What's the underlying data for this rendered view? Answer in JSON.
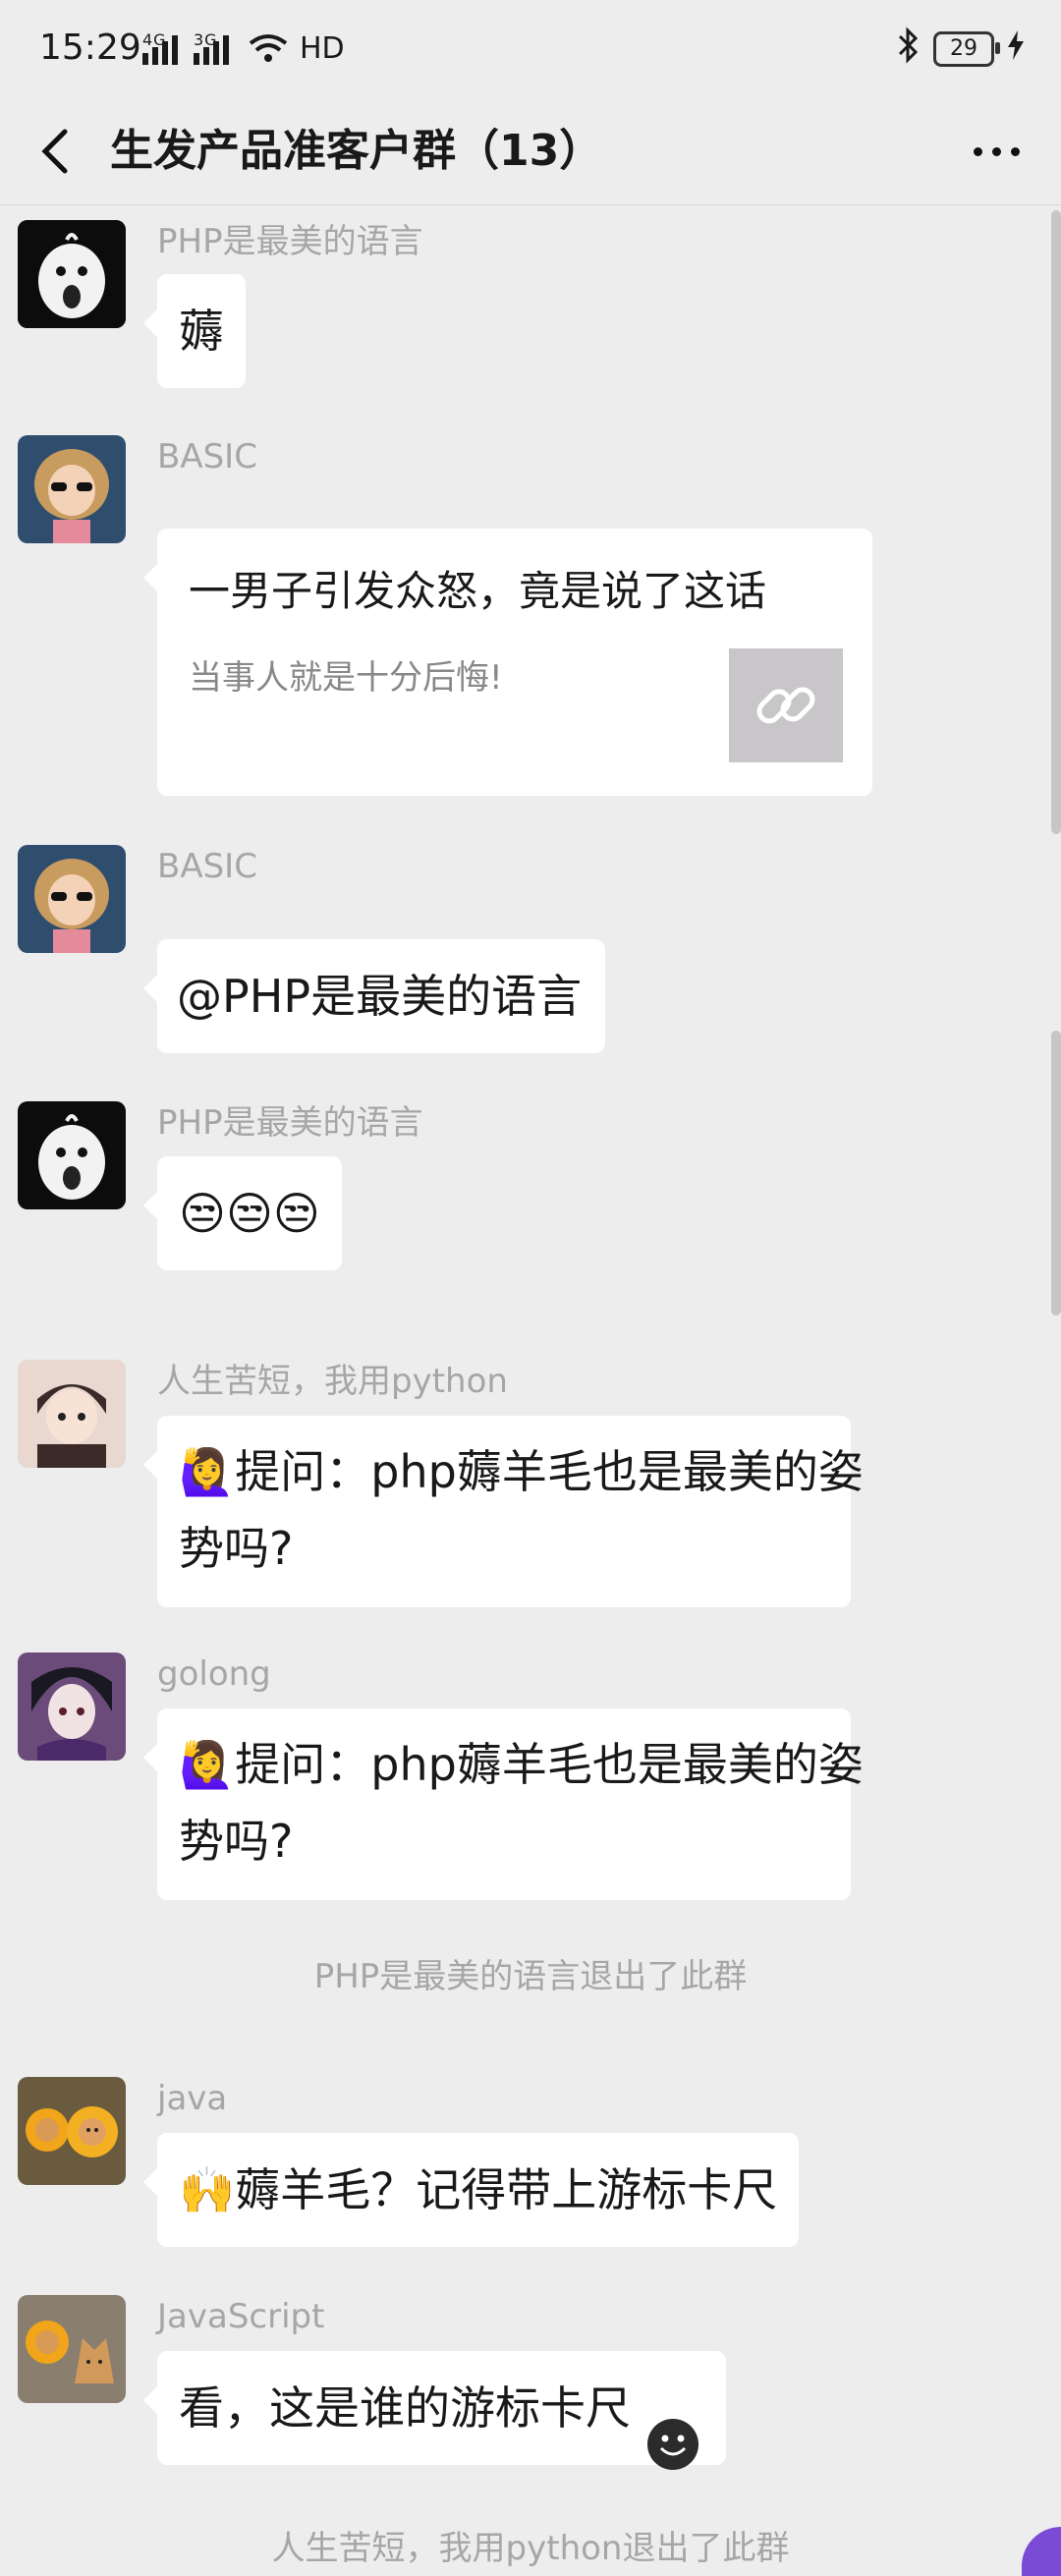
{
  "status_bar": {
    "time": "15:29",
    "network": "4G 3G",
    "wifi_label": "HD",
    "battery": "29"
  },
  "header": {
    "title": "生发产品准客户群（13）"
  },
  "messages": [
    {
      "sender": "PHP是最美的语言",
      "text": "薅"
    },
    {
      "sender": "BASIC",
      "link_title": "一男子引发众怒，竟是说了这话",
      "link_desc": "当事人就是十分后悔!"
    },
    {
      "sender": "BASIC",
      "text": "@PHP是最美的语言"
    },
    {
      "sender": "PHP是最美的语言",
      "text": "😒😒😒"
    },
    {
      "sender": "人生苦短，我用python",
      "text_line1": "🙋‍♀️提问：php薅羊毛也是最美的姿",
      "text_line2": "势吗?"
    },
    {
      "sender": "golong",
      "text_line1": "🙋‍♀️提问：php薅羊毛也是最美的姿",
      "text_line2": "势吗?"
    },
    {
      "sender": "java",
      "text": "🙌薅羊毛？记得带上游标卡尺"
    },
    {
      "sender": "JavaScript",
      "text": "看，这是谁的游标卡尺"
    }
  ],
  "system_messages": [
    "PHP是最美的语言退出了此群",
    "人生苦短，我用python退出了此群"
  ],
  "colors": {
    "background": "#ededed",
    "bubble": "#ffffff",
    "sender": "#a6a6a6"
  }
}
